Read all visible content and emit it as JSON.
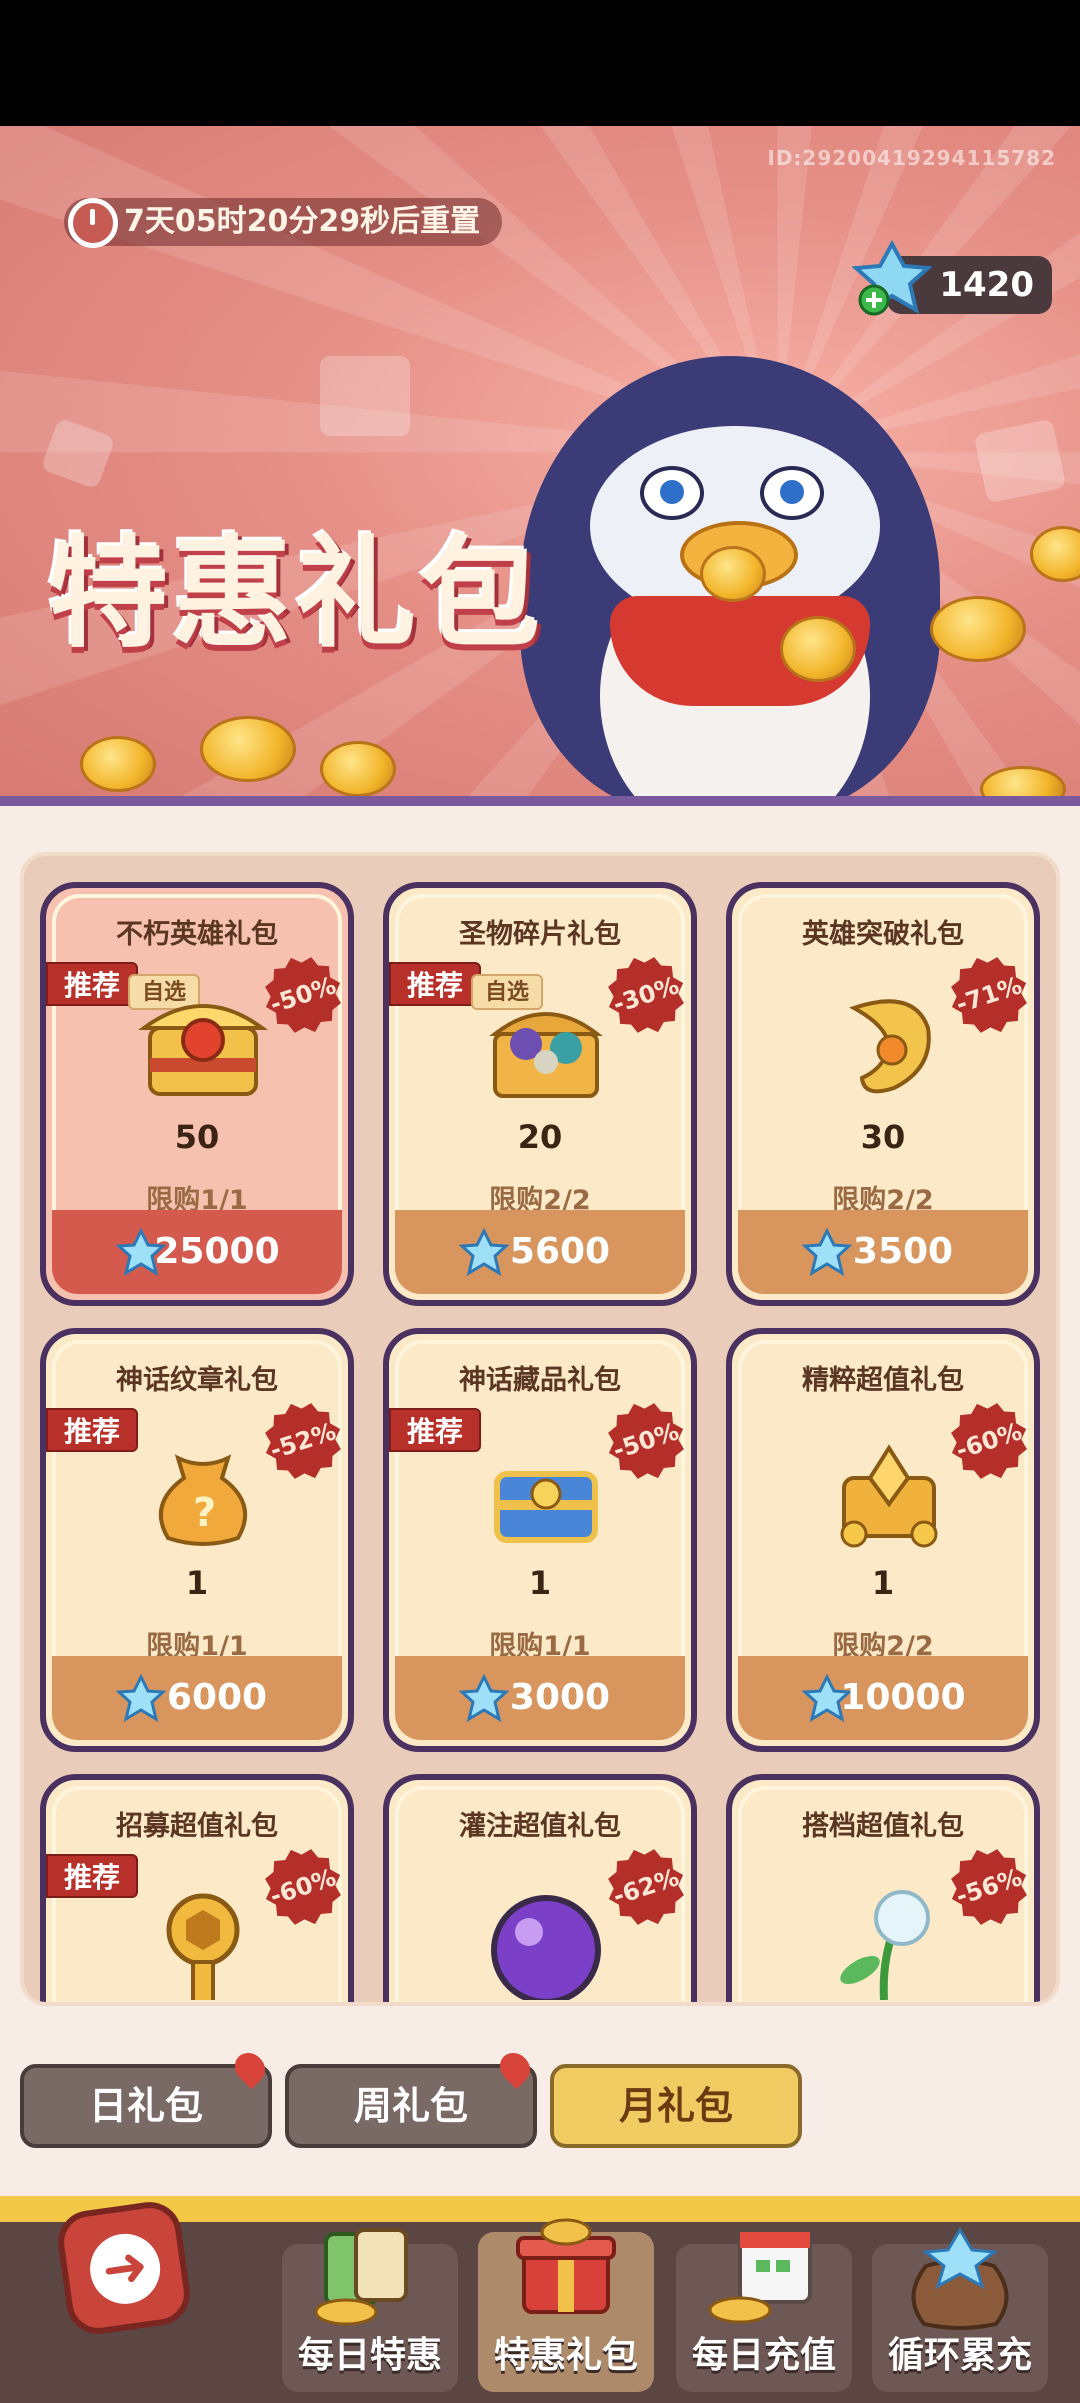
{
  "banner": {
    "id_text": "ID:29200419294115782",
    "timer": "7天05时20分29秒后重置",
    "gems": "1420",
    "title": "特惠礼包"
  },
  "cards": [
    {
      "name": "不朽英雄礼包",
      "tag": "推荐",
      "select": "自选",
      "discount": "-50%",
      "qty": "50",
      "limit": "限购1/1",
      "price": "25000",
      "highlight": true,
      "icon": "hero-chest-icon"
    },
    {
      "name": "圣物碎片礼包",
      "tag": "推荐",
      "select": "自选",
      "discount": "-30%",
      "qty": "20",
      "limit": "限购2/2",
      "price": "5600",
      "icon": "relic-chest-icon"
    },
    {
      "name": "英雄突破礼包",
      "tag": "",
      "select": "",
      "discount": "-71%",
      "qty": "30",
      "limit": "限购2/2",
      "price": "3500",
      "icon": "golden-horn-icon"
    },
    {
      "name": "神话纹章礼包",
      "tag": "推荐",
      "select": "",
      "discount": "-52%",
      "qty": "1",
      "limit": "限购1/1",
      "price": "6000",
      "icon": "mystery-bag-icon"
    },
    {
      "name": "神话藏品礼包",
      "tag": "推荐",
      "select": "",
      "discount": "-50%",
      "qty": "1",
      "limit": "限购1/1",
      "price": "3000",
      "icon": "blue-chest-icon"
    },
    {
      "name": "精粹超值礼包",
      "tag": "",
      "select": "",
      "discount": "-60%",
      "qty": "1",
      "limit": "限购2/2",
      "price": "10000",
      "icon": "gold-treasure-icon"
    },
    {
      "name": "招募超值礼包",
      "tag": "推荐",
      "select": "",
      "discount": "-60%",
      "qty": "",
      "limit": "",
      "price": "",
      "icon": "gold-key-icon"
    },
    {
      "name": "灌注超值礼包",
      "tag": "",
      "select": "",
      "discount": "-62%",
      "qty": "",
      "limit": "",
      "price": "",
      "icon": "purple-orb-icon"
    },
    {
      "name": "搭档超值礼包",
      "tag": "",
      "select": "",
      "discount": "-56%",
      "qty": "",
      "limit": "",
      "price": "",
      "icon": "ice-flower-icon"
    }
  ],
  "tabs": [
    "日礼包",
    "周礼包",
    "月礼包"
  ],
  "nav": [
    "每日特惠",
    "特惠礼包",
    "每日充值",
    "循环累充"
  ],
  "colors": {
    "accent": "#f0cc63",
    "card_border": "#4a3160",
    "price_bar": "#d8955d",
    "tag_red": "#b8302a"
  }
}
